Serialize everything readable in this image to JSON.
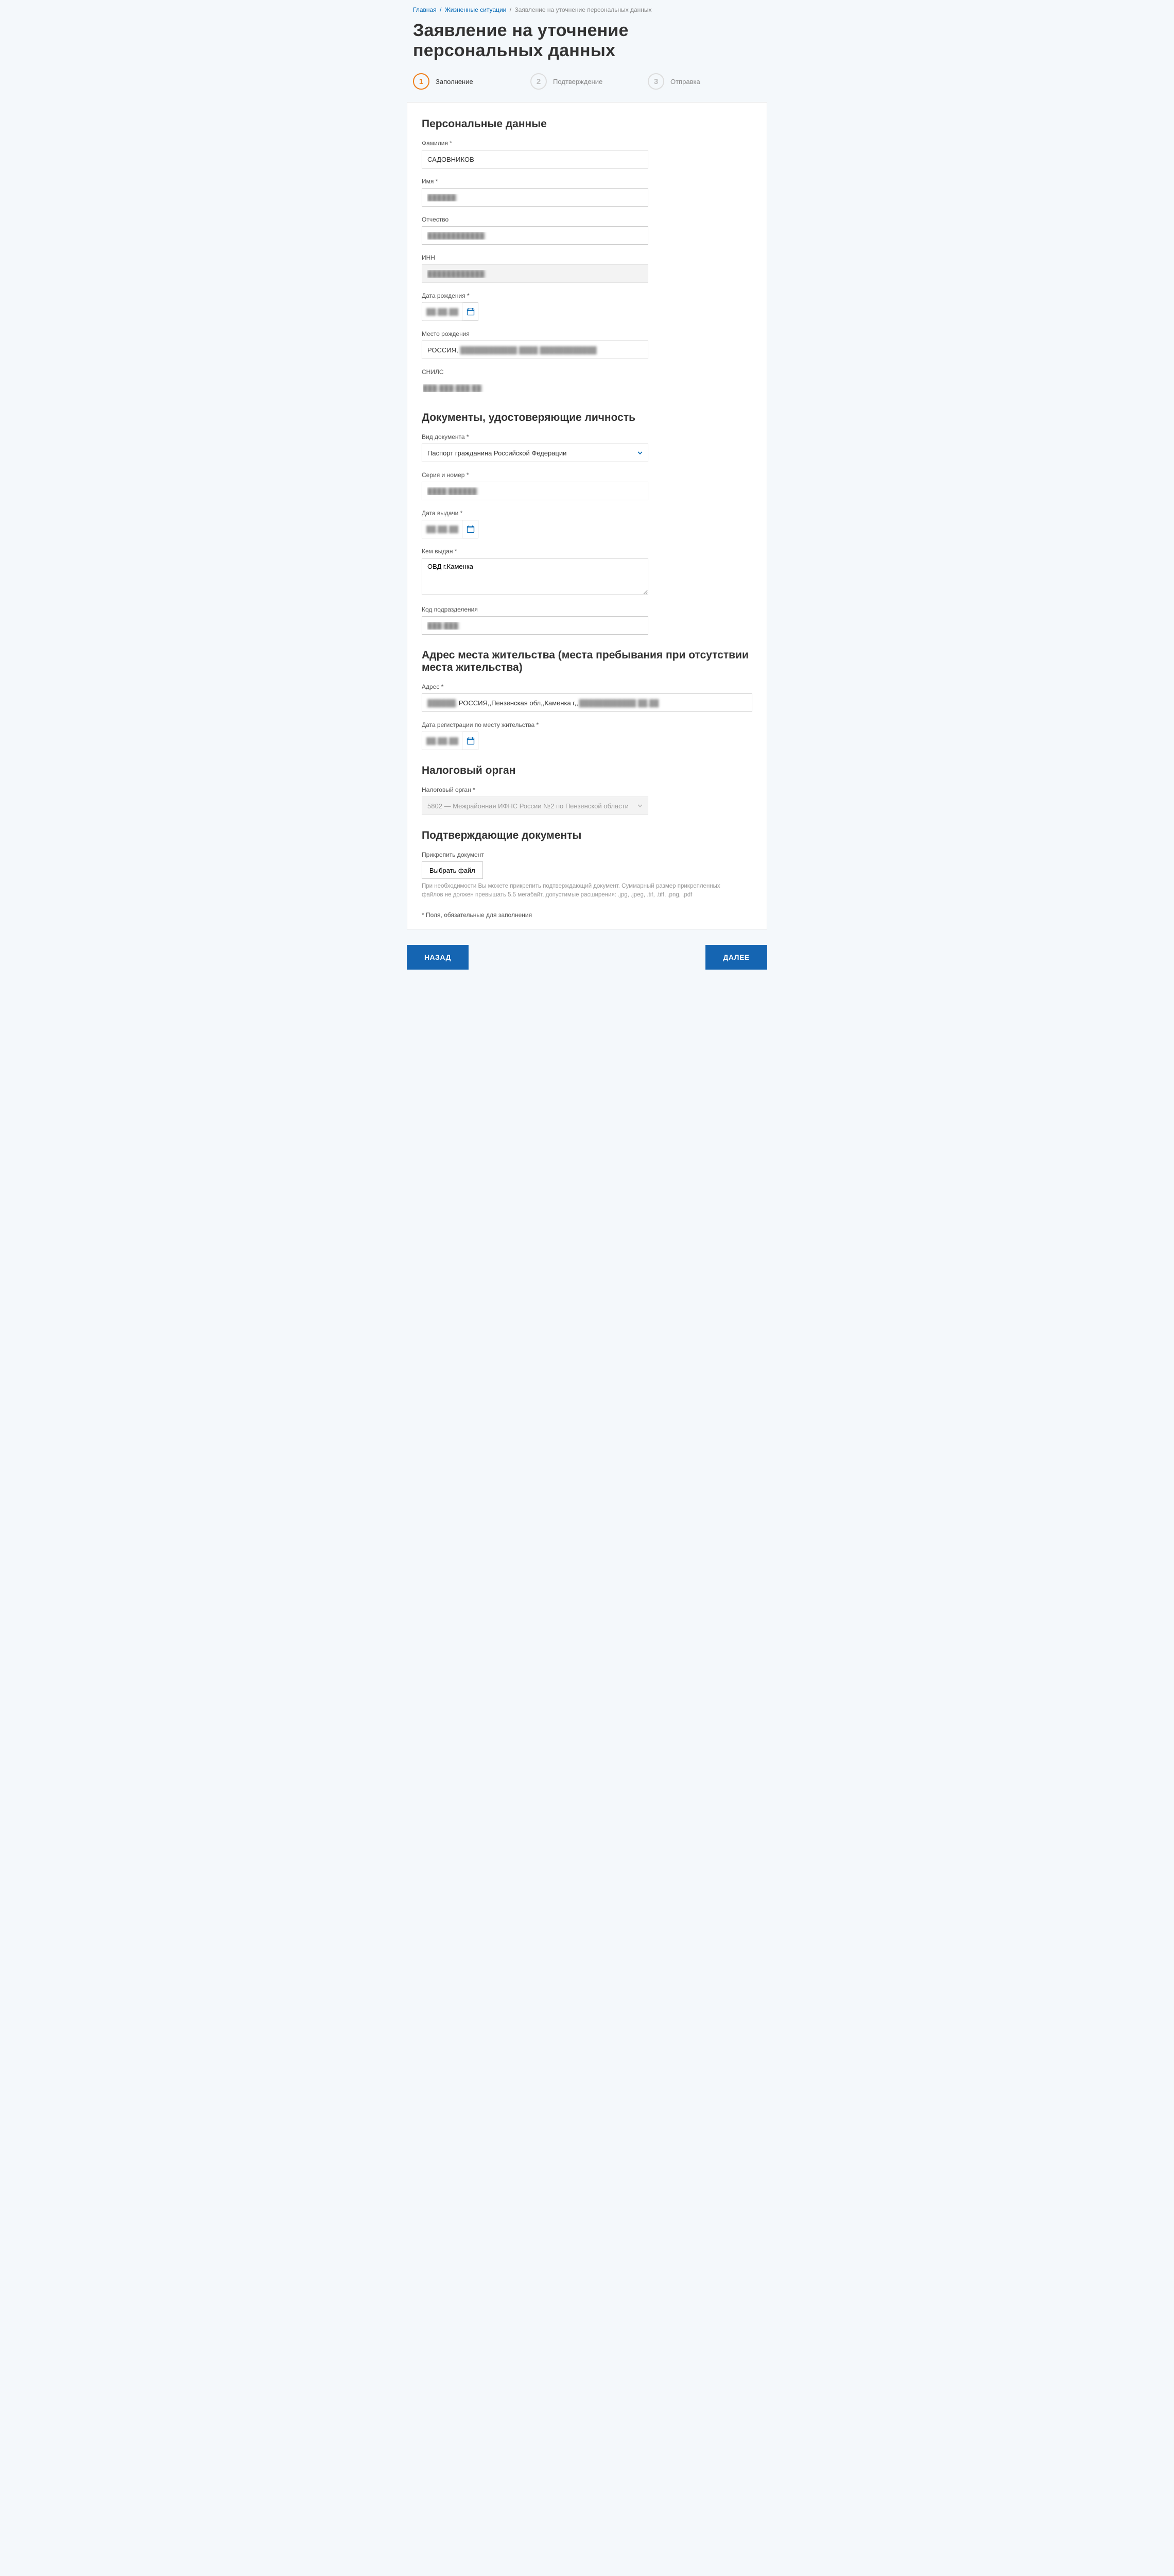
{
  "breadcrumb": {
    "home": "Главная",
    "situations": "Жизненные ситуации",
    "current": "Заявление на уточнение персональных данных"
  },
  "page_title": "Заявление на уточнение персональных данных",
  "steps": [
    {
      "num": "1",
      "label": "Заполнение",
      "active": true
    },
    {
      "num": "2",
      "label": "Подтверждение",
      "active": false
    },
    {
      "num": "3",
      "label": "Отправка",
      "active": false
    }
  ],
  "sections": {
    "personal": {
      "title": "Персональные данные",
      "fields": {
        "surname": {
          "label": "Фамилия *",
          "value": "САДОВНИКОВ"
        },
        "name": {
          "label": "Имя *",
          "value": "██████"
        },
        "patronymic": {
          "label": "Отчество",
          "value": "████████████"
        },
        "inn": {
          "label": "ИНН",
          "value": "████████████"
        },
        "birth_date": {
          "label": "Дата рождения *",
          "value": "██.██.████"
        },
        "birth_place": {
          "label": "Место рождения",
          "prefix": "РОССИЯ, ",
          "rest": "████████████ ████ ████████████"
        },
        "snils": {
          "label": "СНИЛС",
          "value": "███-███-███ ██"
        }
      }
    },
    "identity": {
      "title": "Документы, удостоверяющие личность",
      "fields": {
        "doc_type": {
          "label": "Вид документа *",
          "value": "Паспорт гражданина Российской Федерации"
        },
        "series_num": {
          "label": "Серия и номер *",
          "value": "████ ██████"
        },
        "issue_date": {
          "label": "Дата выдачи *",
          "value": "██.██.████"
        },
        "issued_by": {
          "label": "Кем выдан *",
          "value": "ОВД г.Каменка"
        },
        "division_code": {
          "label": "Код подразделения",
          "value": "███-███"
        }
      }
    },
    "address": {
      "title": "Адрес места жительства (места пребывания при отсутствии места жительства)",
      "fields": {
        "address": {
          "label": "Адрес *",
          "prefix_blur": "██████,",
          "clear": "РОССИЯ,,Пензенская обл,,Каменка г,,",
          "suffix_blur": "████████████ ██,██"
        },
        "reg_date": {
          "label": "Дата регистрации по месту жительства *",
          "value": "██.██.████"
        }
      }
    },
    "tax": {
      "title": "Налоговый орган",
      "fields": {
        "authority": {
          "label": "Налоговый орган *",
          "value": "5802 — Межрайонная ИФНС России №2 по Пензенской области"
        }
      }
    },
    "docs": {
      "title": "Подтверждающие документы",
      "attach_label": "Прикрепить документ",
      "file_button": "Выбрать файл",
      "help": "При необходимости Вы можете прикрепить подтверждающий документ. Суммарный размер прикрепленных файлов не должен превышать 5.5 мегабайт, допустимые расширения: .jpg, .jpeg, .tif, .tiff, .png, .pdf",
      "required_note": "* Поля, обязательные для заполнения"
    }
  },
  "buttons": {
    "back": "НАЗАД",
    "next": "ДАЛЕЕ"
  }
}
